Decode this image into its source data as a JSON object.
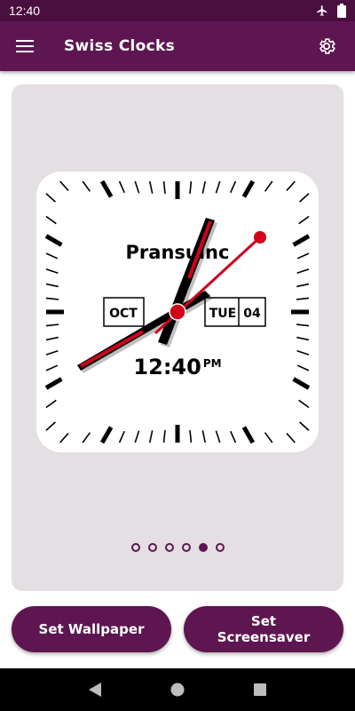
{
  "status_bar": {
    "time": "12:40"
  },
  "app_bar": {
    "title": "Swiss Clocks"
  },
  "clock": {
    "brand": "Pransuinc",
    "month": "OCT",
    "weekday": "TUE",
    "day": "04",
    "digital_time": "12:40",
    "ampm": "PM",
    "colors": {
      "hands": "#000000",
      "second_hand": "#d0021b"
    }
  },
  "pager": {
    "pages": 6,
    "active_page": 5
  },
  "buttons": {
    "set_wallpaper": "Set Wallpaper",
    "set_screensaver_line1": "Set",
    "set_screensaver_line2": "Screensaver"
  },
  "colors": {
    "primary": "#5e1650",
    "status_bar": "#4a0f3e",
    "card": "#e4dfe3"
  }
}
